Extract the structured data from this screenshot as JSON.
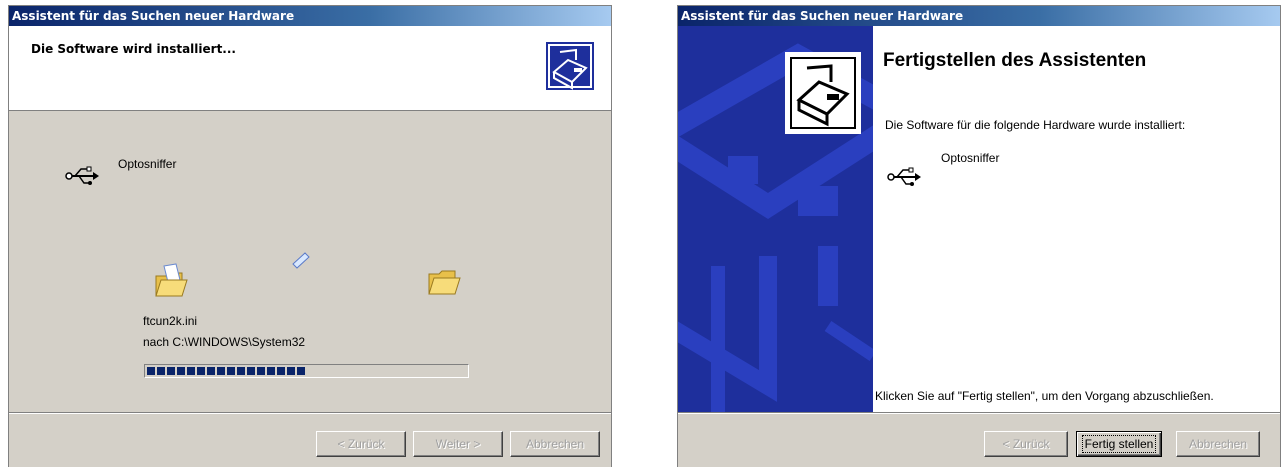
{
  "left_window": {
    "title": "Assistent für das Suchen neuer Hardware",
    "header_title": "Die Software wird installiert...",
    "device_name": "Optosniffer",
    "file_name": "ftcun2k.ini",
    "destination": "nach C:\\WINDOWS\\System32",
    "progress_fraction": 0.5,
    "buttons": {
      "back": "< Zurück",
      "next": "Weiter >",
      "cancel": "Abbrechen"
    },
    "icons": [
      "hardware-wizard-icon",
      "usb-icon",
      "folder-icon",
      "flying-paper-icon"
    ]
  },
  "right_window": {
    "title": "Assistent für das Suchen neuer Hardware",
    "heading": "Fertigstellen des Assistenten",
    "intro": "Die Software für die folgende Hardware wurde installiert:",
    "device_name": "Optosniffer",
    "finish_hint": "Klicken Sie auf \"Fertig stellen\", um den Vorgang abzuschließen.",
    "buttons": {
      "back": "< Zurück",
      "finish": "Fertig stellen",
      "cancel": "Abbrechen"
    },
    "icons": [
      "hardware-wizard-icon",
      "usb-icon"
    ]
  },
  "colors": {
    "titlebar": "#0a246a",
    "sidebar": "#1e2f9c",
    "dialog": "#d4d0c8",
    "progress": "#0a246a"
  }
}
